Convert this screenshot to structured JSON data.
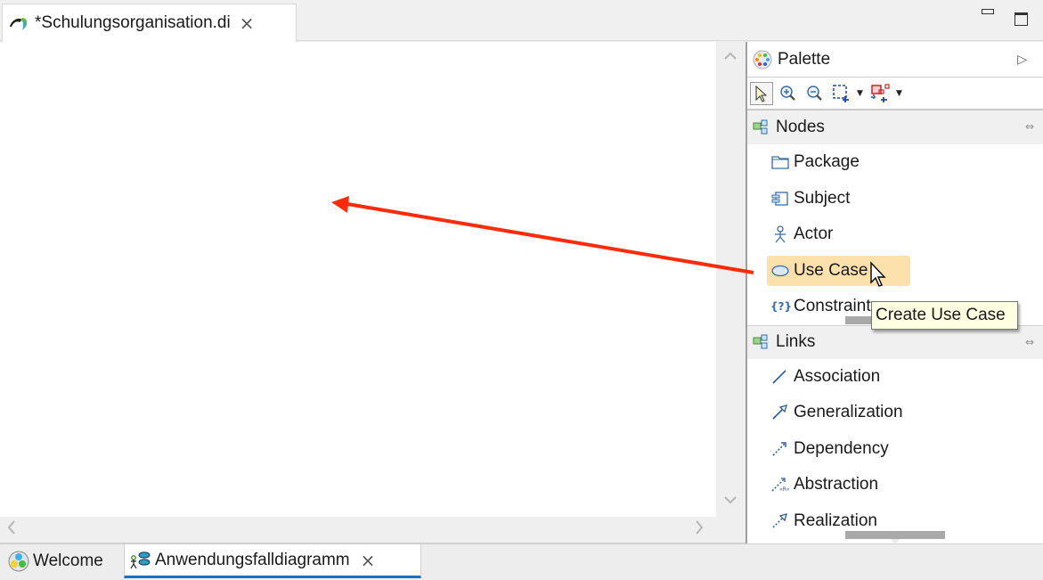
{
  "editor": {
    "tab_title": "*Schulungsorganisation.di",
    "close_glyph": "×",
    "window_controls": {
      "minimize": "minimize-icon",
      "maximize": "maximize-icon"
    }
  },
  "scrollbars": {
    "up": "˄",
    "down": "˅",
    "left": "<",
    "right": ">"
  },
  "palette": {
    "title": "Palette",
    "collapse_glyph": "▷",
    "toolbar": [
      "select-tool",
      "zoom-in-tool",
      "zoom-out-tool",
      "marquee-tool",
      "connection-marquee-tool"
    ],
    "drawers": [
      {
        "label": "Nodes",
        "pin_glyph": "⇔",
        "entries": [
          {
            "label": "Package",
            "icon": "package-icon"
          },
          {
            "label": "Subject",
            "icon": "subject-icon"
          },
          {
            "label": "Actor",
            "icon": "actor-icon"
          },
          {
            "label": "Use Case",
            "icon": "use-case-icon",
            "hovered": true
          },
          {
            "label": "Constraint",
            "icon": "constraint-icon"
          }
        ]
      },
      {
        "label": "Links",
        "pin_glyph": "⇔",
        "entries": [
          {
            "label": "Association",
            "icon": "association-icon"
          },
          {
            "label": "Generalization",
            "icon": "generalization-icon"
          },
          {
            "label": "Dependency",
            "icon": "dependency-icon"
          },
          {
            "label": "Abstraction",
            "icon": "abstraction-icon"
          },
          {
            "label": "Realization",
            "icon": "realization-icon"
          }
        ]
      }
    ]
  },
  "tooltip": {
    "text": "Create Use Case"
  },
  "annotation": {
    "type": "arrow",
    "color": "#ff2a0a",
    "meaning": "drag Use Case from palette onto canvas"
  },
  "bottom_tabs": [
    {
      "label": "Welcome",
      "icon": "welcome-icon",
      "active": false
    },
    {
      "label": "Anwendungsfalldiagramm",
      "icon": "use-case-diagram-icon",
      "active": true,
      "close_glyph": "×"
    }
  ],
  "colors": {
    "hover_highlight": "#fce1ad",
    "tooltip_bg": "#ffffe1",
    "active_tab_underline": "#1e6fc4",
    "arrow": "#ff2a0a"
  }
}
